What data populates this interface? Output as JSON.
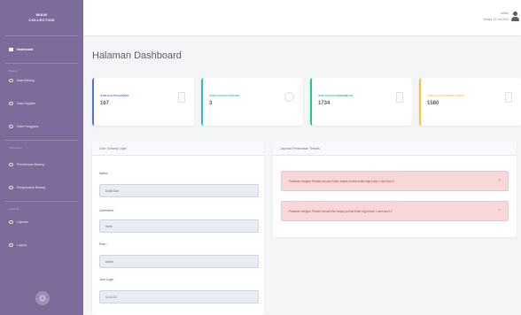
{
  "brand": {
    "line1": "MIANI",
    "line2": "COLLECTION"
  },
  "sidebar": {
    "dashboard": "Dashboard",
    "heading1": "Master",
    "items1": [
      "Data Barang",
      "Data Supplier",
      "Data Pengguna"
    ],
    "heading2": "Transaksi",
    "items2": [
      "Penerimaan Barang",
      "Pengeluaran Barang"
    ],
    "heading3": "Laporan",
    "items3": [
      "Laporan",
      "Logout"
    ]
  },
  "topbar": {
    "user_name": "Admin",
    "user_date": "Selasa, 12 Juli 2022"
  },
  "page_title": "Halaman Dashboard",
  "stats": [
    {
      "label": "Jumlah Data Barang",
      "value": "167",
      "color": "#4e73df"
    },
    {
      "label": "Jumlah Data Supplier",
      "value": "3",
      "color": "#36b9cc"
    },
    {
      "label": "Jumlah Data Penerimaan",
      "value": "1734",
      "color": "#1cc88a"
    },
    {
      "label": "Jumlah Data Pengeluaran",
      "value": "1580",
      "color": "#f6c23e"
    }
  ],
  "user_panel": {
    "title": "User Sedang Login",
    "name_label": "Nama :",
    "name_value": "Dwita Sari",
    "username_label": "Username :",
    "username_value": "dwita",
    "role_label": "Role :",
    "role_value": "admin",
    "login_label": "Jam Login :",
    "login_value": "11:44:33"
  },
  "notif_panel": {
    "title": "Laporan Persediaan Terbaik",
    "alerts": [
      "Pesanan dengan Pesalin secara Robin tanpa produk telah digi untuk 1 dari dua 8",
      "Pesanan dengan Pesalin secara Bin tanpa produk telah digi untuk 1 dari dua 12"
    ]
  }
}
